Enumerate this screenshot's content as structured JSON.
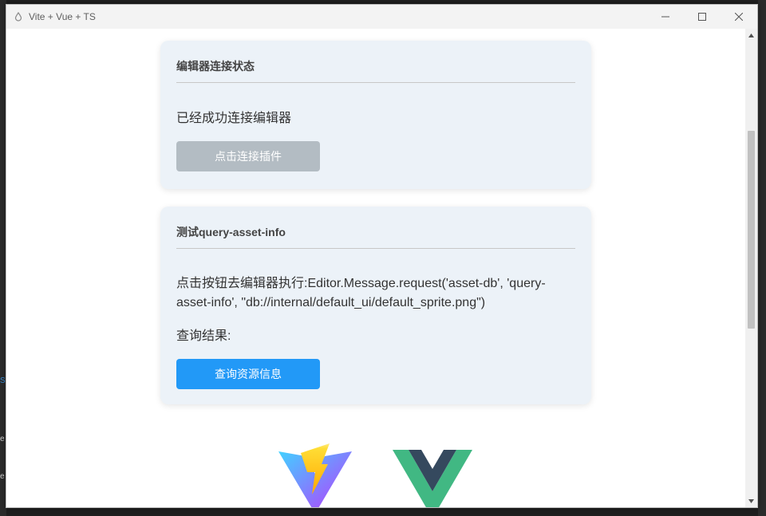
{
  "window": {
    "title": "Vite + Vue + TS"
  },
  "background": {
    "left_marks": [
      "S",
      "e",
      "e"
    ]
  },
  "card_connection": {
    "title": "编辑器连接状态",
    "status": "已经成功连接编辑器",
    "button_label": "点击连接插件"
  },
  "card_query": {
    "title": "测试query-asset-info",
    "request_text": "点击按钮去编辑器执行:Editor.Message.request('asset-db', 'query-asset-info', \"db://internal/default_ui/default_sprite.png\")",
    "result_label": "查询结果:",
    "button_label": "查询资源信息"
  },
  "logos": [
    "vite-logo",
    "vue-logo"
  ],
  "colors": {
    "card_bg": "#ecf2f8",
    "primary_button": "#2299f7",
    "disabled_button": "#b3bcc3",
    "vue_green": "#41b883",
    "vue_dark": "#35495e"
  }
}
